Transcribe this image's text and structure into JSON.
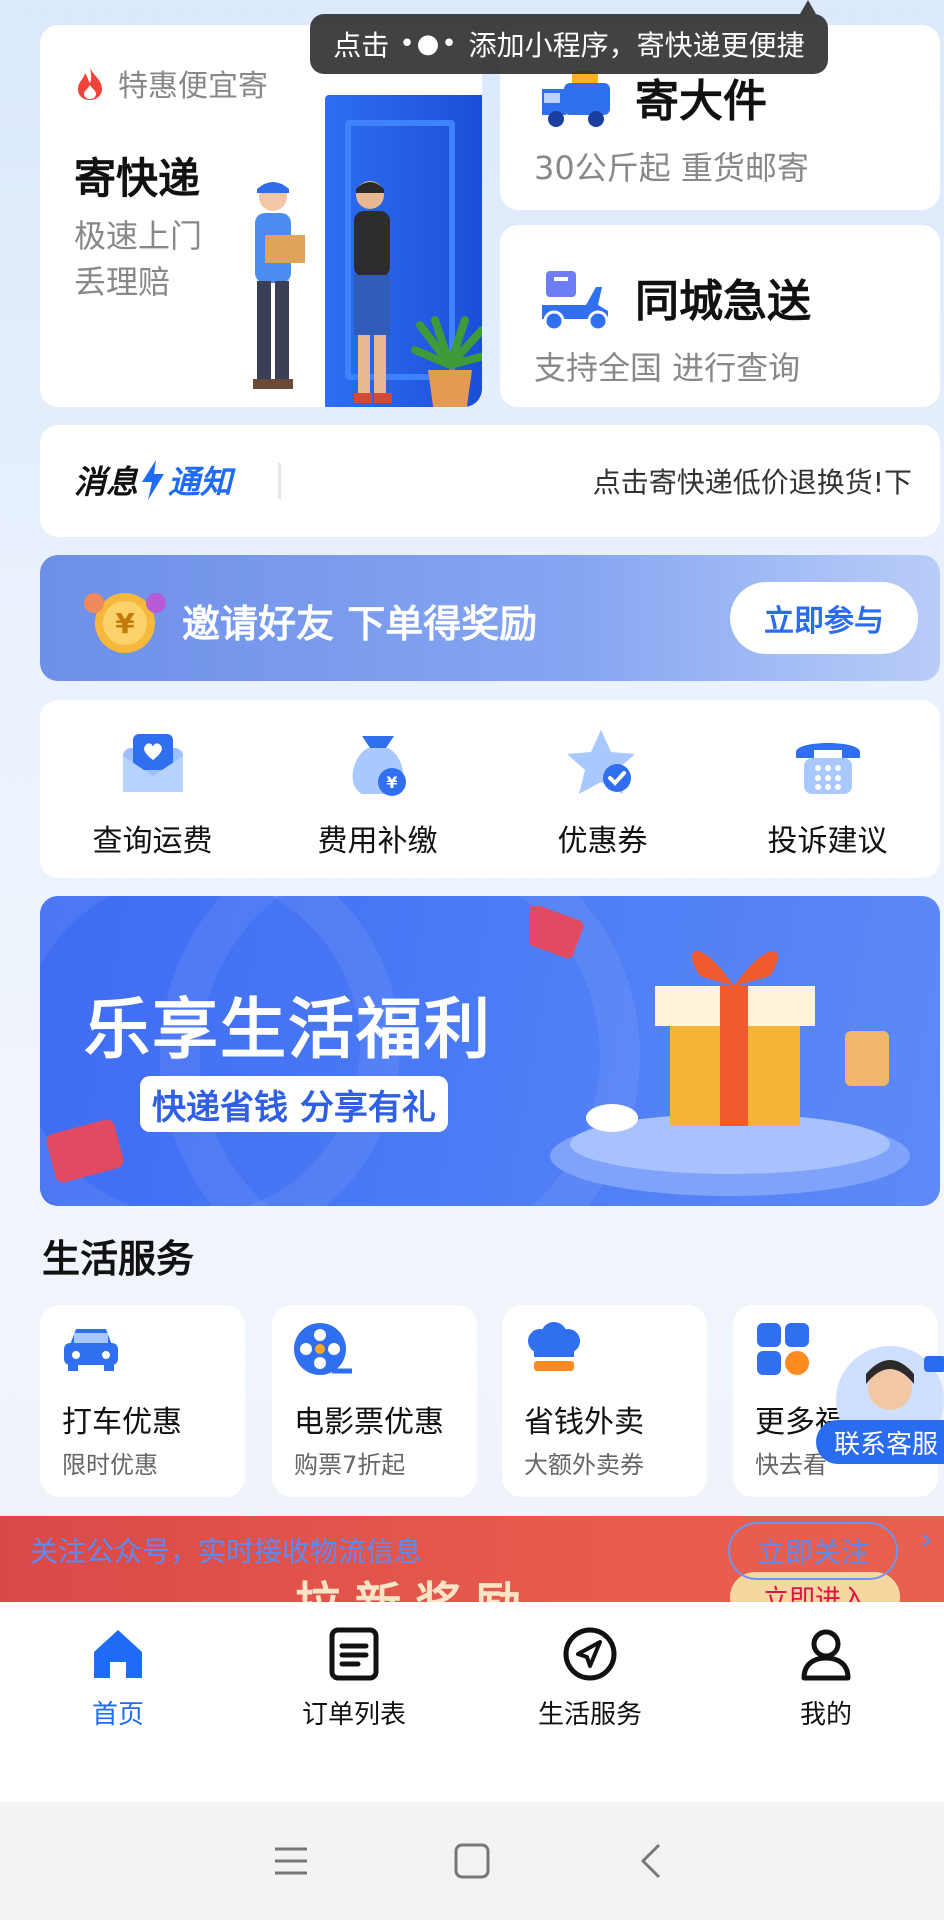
{
  "tooltip": {
    "prefix": "点击",
    "dots": "•●•",
    "text": "添加小程序，寄快递更便捷"
  },
  "main_card": {
    "tag": "特惠便宜寄",
    "title": "寄快递",
    "subtitle": "极速上门\n丢理赔"
  },
  "big_parcel": {
    "title": "寄大件",
    "subtitle": "30公斤起 重货邮寄"
  },
  "city_express": {
    "title": "同城急送",
    "subtitle": "支持全国 进行查询"
  },
  "notice": {
    "logo_a": "消息",
    "logo_b": "通知",
    "text": "点击寄快递低价退换货!下"
  },
  "invite": {
    "text": "邀请好友 下单得奖励",
    "button": "立即参与"
  },
  "shortcuts": [
    {
      "label": "查询运费",
      "icon": "envelope-heart-icon"
    },
    {
      "label": "费用补缴",
      "icon": "money-bag-icon"
    },
    {
      "label": "优惠券",
      "icon": "star-check-icon"
    },
    {
      "label": "投诉建议",
      "icon": "phone-icon"
    }
  ],
  "promo": {
    "title": "乐享生活福利",
    "subtitle": "快递省钱 分享有礼"
  },
  "life_services": {
    "title": "生活服务",
    "items": [
      {
        "title": "打车优惠",
        "sub": "限时优惠",
        "icon": "car-icon"
      },
      {
        "title": "电影票优惠",
        "sub": "购票7折起",
        "icon": "film-reel-icon"
      },
      {
        "title": "省钱外卖",
        "sub": "大额外卖券",
        "icon": "chef-hat-icon"
      },
      {
        "title": "更多福",
        "sub": "快去看",
        "icon": "grid-apps-icon"
      }
    ]
  },
  "customer_service": {
    "label": "联系客服"
  },
  "follow_bar": {
    "text": "关注公众号，实时接收物流信息",
    "button": "立即关注",
    "ghost_text": "拉新奖励",
    "ghost_button": "立即进入"
  },
  "tabbar": [
    {
      "label": "首页",
      "icon": "home-icon",
      "active": true
    },
    {
      "label": "订单列表",
      "icon": "list-icon",
      "active": false
    },
    {
      "label": "生活服务",
      "icon": "compass-icon",
      "active": false
    },
    {
      "label": "我的",
      "icon": "user-icon",
      "active": false
    }
  ],
  "colors": {
    "accent": "#1e6cf5",
    "invite_bg": "#7a9aee",
    "follow_bg": "#e3554c"
  }
}
